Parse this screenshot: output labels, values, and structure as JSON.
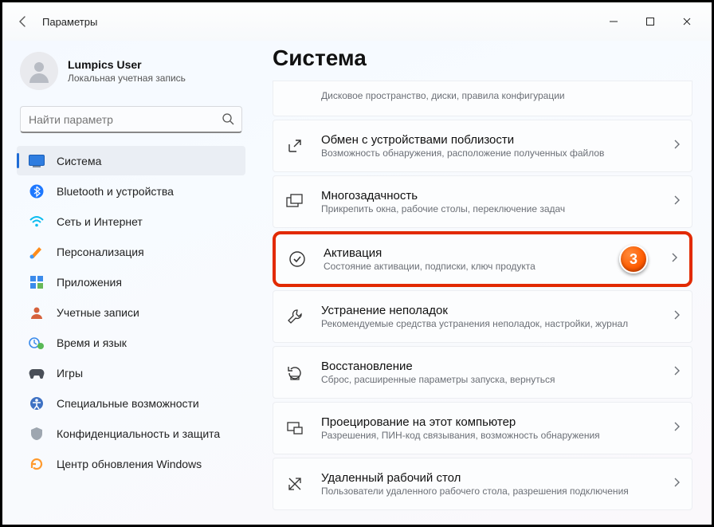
{
  "window": {
    "title": "Параметры"
  },
  "user": {
    "name": "Lumpics User",
    "subtitle": "Локальная учетная запись"
  },
  "search": {
    "placeholder": "Найти параметр"
  },
  "nav": {
    "items": [
      {
        "label": "Система"
      },
      {
        "label": "Bluetooth и устройства"
      },
      {
        "label": "Сеть и Интернет"
      },
      {
        "label": "Персонализация"
      },
      {
        "label": "Приложения"
      },
      {
        "label": "Учетные записи"
      },
      {
        "label": "Время и язык"
      },
      {
        "label": "Игры"
      },
      {
        "label": "Специальные возможности"
      },
      {
        "label": "Конфиденциальность и защита"
      },
      {
        "label": "Центр обновления Windows"
      }
    ]
  },
  "main": {
    "heading": "Система",
    "cards": {
      "storage_sub": "Дисковое пространство, диски, правила конфигурации",
      "nearby": {
        "title": "Обмен с устройствами поблизости",
        "sub": "Возможность обнаружения, расположение полученных файлов"
      },
      "multitask": {
        "title": "Многозадачность",
        "sub": "Прикрепить окна, рабочие столы, переключение задач"
      },
      "activation": {
        "title": "Активация",
        "sub": "Состояние активации, подписки, ключ продукта"
      },
      "troubleshoot": {
        "title": "Устранение неполадок",
        "sub": "Рекомендуемые средства устранения неполадок, настройки, журнал"
      },
      "recovery": {
        "title": "Восстановление",
        "sub": "Сброс, расширенные параметры запуска, вернуться"
      },
      "projecting": {
        "title": "Проецирование на этот компьютер",
        "sub": "Разрешения, ПИН-код связывания, возможность обнаружения"
      },
      "remote": {
        "title": "Удаленный рабочий стол",
        "sub": "Пользователи удаленного рабочего стола, разрешения подключения"
      }
    }
  },
  "callout": {
    "number": "3"
  }
}
